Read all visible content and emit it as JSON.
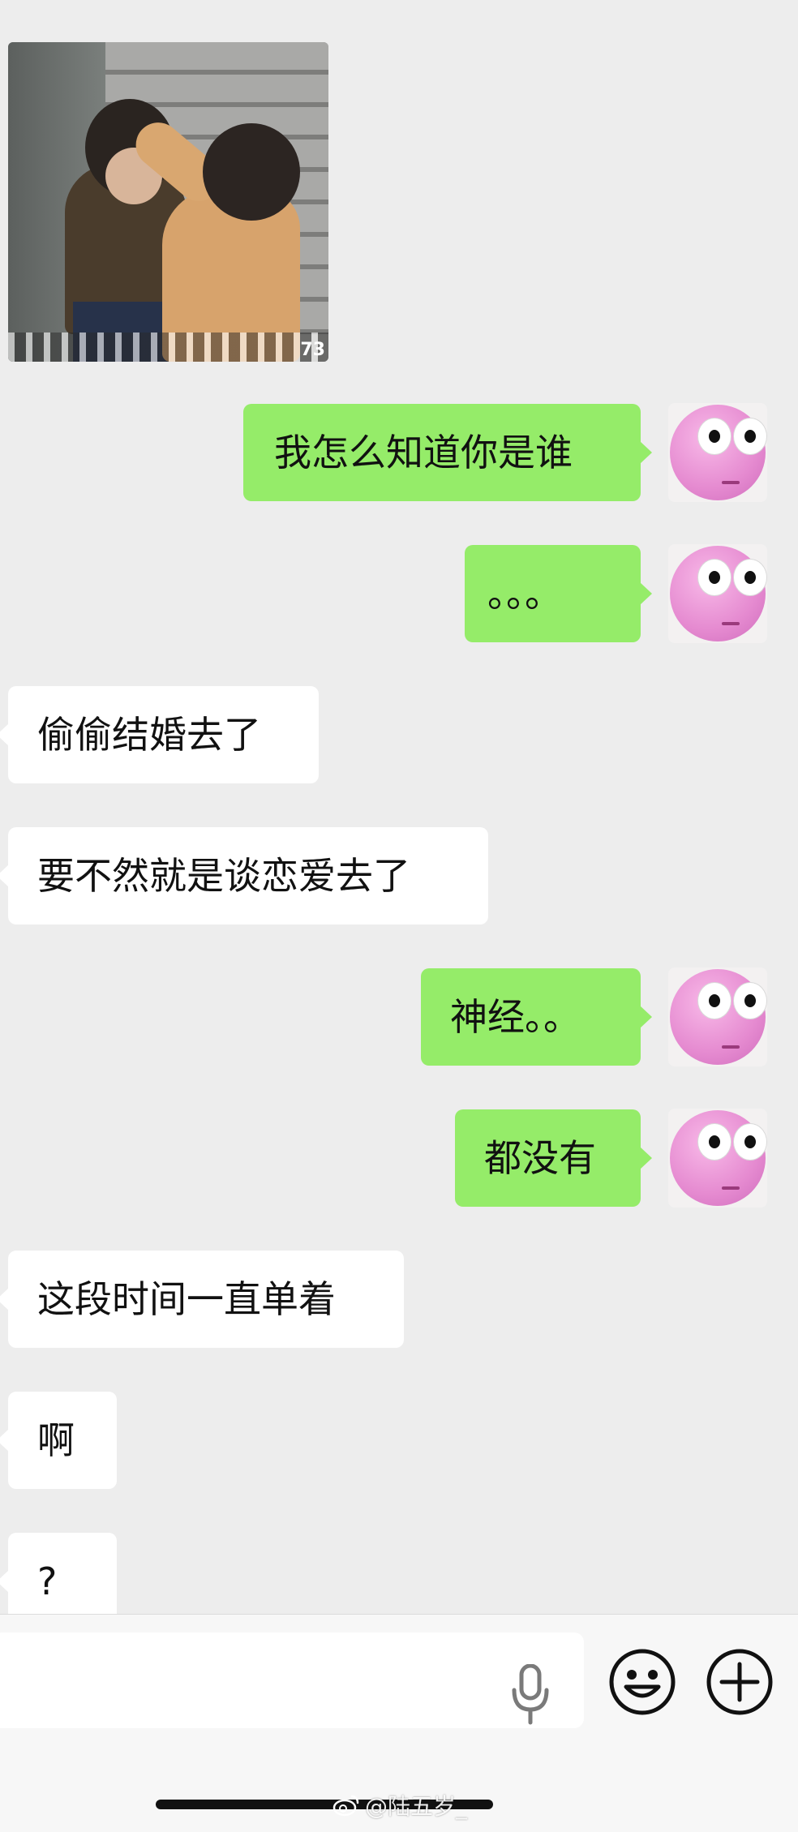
{
  "messages": [
    {
      "side": "received",
      "type": "image",
      "overlay_count": "73"
    },
    {
      "side": "sent",
      "text": "我怎么知道你是谁"
    },
    {
      "side": "sent",
      "text": "。。。"
    },
    {
      "side": "received",
      "text": "偷偷结婚去了"
    },
    {
      "side": "received",
      "text": "要不然就是谈恋爱去了"
    },
    {
      "side": "sent",
      "text": "神经。。"
    },
    {
      "side": "sent",
      "text": "都没有"
    },
    {
      "side": "received",
      "text": "这段时间一直单着"
    },
    {
      "side": "received",
      "text": "啊"
    },
    {
      "side": "received",
      "text": "?"
    }
  ],
  "input_bar": {
    "value": "",
    "icons": [
      "microphone-icon",
      "emoji-icon",
      "plus-icon"
    ]
  },
  "watermark": {
    "text": "@陆五岁_",
    "icon": "weibo-icon"
  },
  "colors": {
    "background": "#ededed",
    "sent_bubble": "#95ec69",
    "received_bubble": "#ffffff",
    "input_bar": "#f7f7f7"
  }
}
